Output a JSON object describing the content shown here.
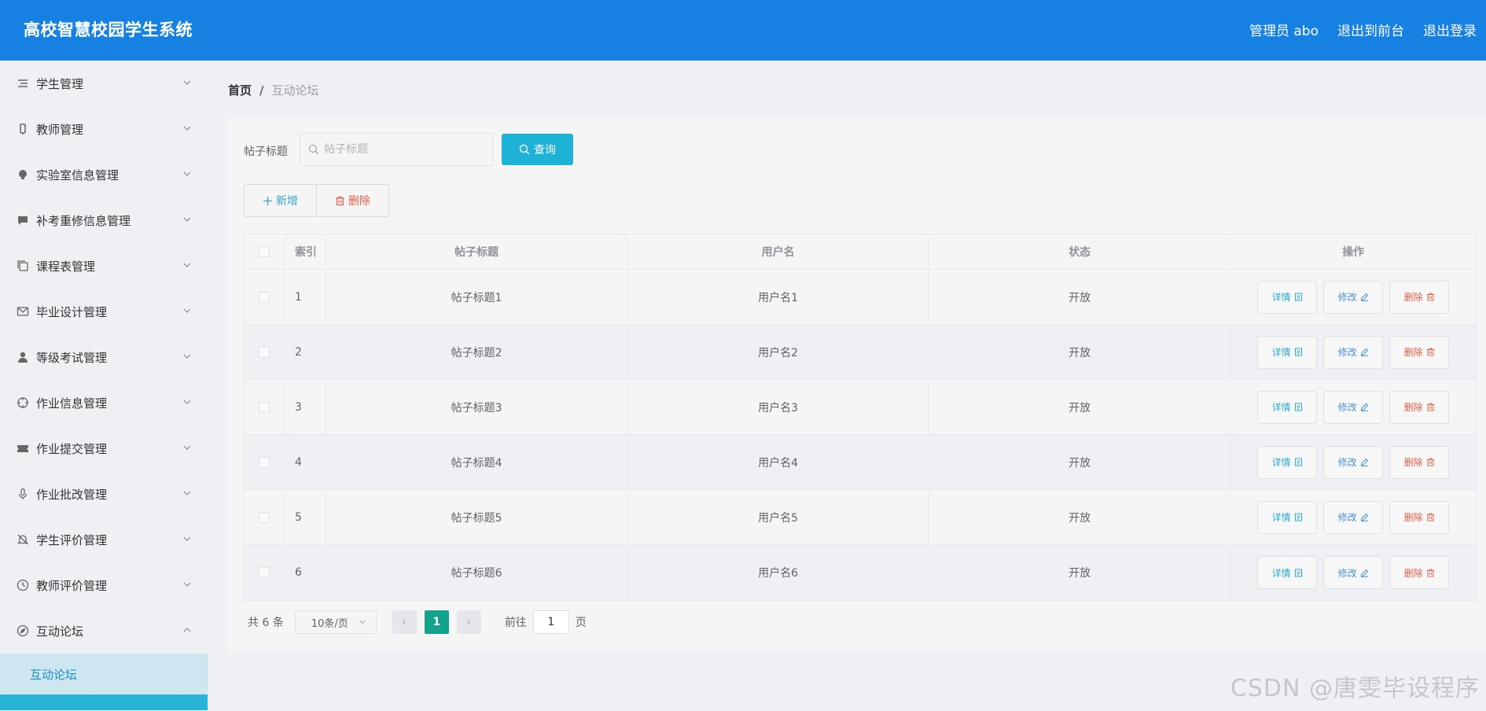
{
  "header": {
    "title": "高校智慧校园学生系统",
    "admin_label": "管理员 abo",
    "exit_front": "退出到前台",
    "logout": "退出登录"
  },
  "sidebar": {
    "items": [
      {
        "label": "学生管理",
        "icon": "list-icon"
      },
      {
        "label": "教师管理",
        "icon": "phone-icon"
      },
      {
        "label": "实验室信息管理",
        "icon": "bulb-icon"
      },
      {
        "label": "补考重修信息管理",
        "icon": "chat-icon"
      },
      {
        "label": "课程表管理",
        "icon": "copy-icon"
      },
      {
        "label": "毕业设计管理",
        "icon": "mail-icon"
      },
      {
        "label": "等级考试管理",
        "icon": "user-icon"
      },
      {
        "label": "作业信息管理",
        "icon": "target-icon"
      },
      {
        "label": "作业提交管理",
        "icon": "ticket-icon"
      },
      {
        "label": "作业批改管理",
        "icon": "mic-icon"
      },
      {
        "label": "学生评价管理",
        "icon": "bell-off-icon"
      },
      {
        "label": "教师评价管理",
        "icon": "clock-icon"
      },
      {
        "label": "互动论坛",
        "icon": "compass-icon"
      }
    ],
    "sub_item": "互动论坛"
  },
  "breadcrumb": {
    "home": "首页",
    "sep": "/",
    "current": "互动论坛"
  },
  "search": {
    "label": "帖子标题",
    "placeholder": "帖子标题",
    "button": "查询"
  },
  "actions": {
    "add": "新增",
    "delete": "删除"
  },
  "table": {
    "headers": [
      "索引",
      "帖子标题",
      "用户名",
      "状态",
      "操作"
    ],
    "rows": [
      {
        "index": "1",
        "title": "帖子标题1",
        "user": "用户名1",
        "status": "开放"
      },
      {
        "index": "2",
        "title": "帖子标题2",
        "user": "用户名2",
        "status": "开放"
      },
      {
        "index": "3",
        "title": "帖子标题3",
        "user": "用户名3",
        "status": "开放"
      },
      {
        "index": "4",
        "title": "帖子标题4",
        "user": "用户名4",
        "status": "开放"
      },
      {
        "index": "5",
        "title": "帖子标题5",
        "user": "用户名5",
        "status": "开放"
      },
      {
        "index": "6",
        "title": "帖子标题6",
        "user": "用户名6",
        "status": "开放"
      }
    ],
    "op_detail": "详情",
    "op_edit": "修改",
    "op_delete": "删除"
  },
  "pager": {
    "total": "共 6 条",
    "size": "10条/页",
    "current_page": "1",
    "goto_label": "前往",
    "goto_value": "1",
    "page_suffix": "页"
  },
  "watermark": "CSDN @唐雯毕设程序",
  "colors": {
    "header_bg": "#1681e3",
    "primary": "#1eb2d6",
    "active_page": "#13a28b",
    "danger": "#e2604a"
  }
}
